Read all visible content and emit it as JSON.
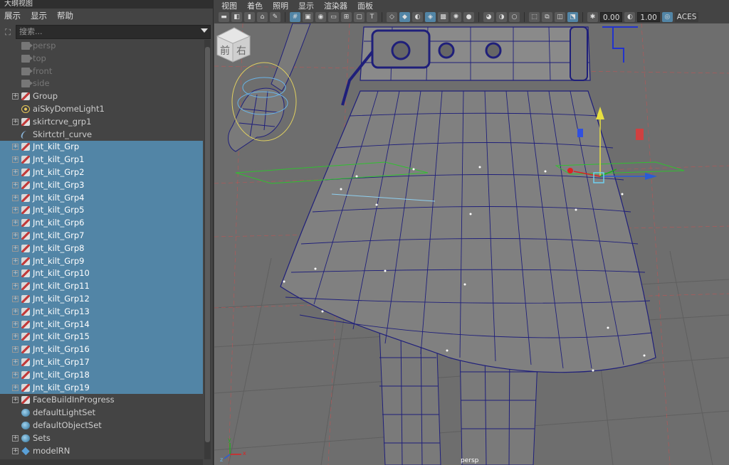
{
  "outliner": {
    "title": "大纲视图",
    "menu": [
      "展示",
      "显示",
      "帮助"
    ],
    "search_placeholder": "搜索...",
    "items": [
      {
        "label": "persp",
        "icon": "camera-icon",
        "dim": true,
        "expand": false,
        "selected": false
      },
      {
        "label": "top",
        "icon": "camera-icon",
        "dim": true,
        "expand": false,
        "selected": false
      },
      {
        "label": "front",
        "icon": "camera-icon",
        "dim": true,
        "expand": false,
        "selected": false
      },
      {
        "label": "side",
        "icon": "camera-icon",
        "dim": true,
        "expand": false,
        "selected": false
      },
      {
        "label": "Group",
        "icon": "group-icon",
        "dim": false,
        "expand": true,
        "selected": false
      },
      {
        "label": "aiSkyDomeLight1",
        "icon": "skydome-light-icon",
        "dim": false,
        "expand": false,
        "selected": false
      },
      {
        "label": "skirtcrve_grp1",
        "icon": "group-icon",
        "dim": false,
        "expand": true,
        "selected": false
      },
      {
        "label": "Skirtctrl_curve",
        "icon": "curve-icon",
        "dim": false,
        "expand": false,
        "selected": false
      },
      {
        "label": "Jnt_kilt_Grp",
        "icon": "group-icon",
        "dim": false,
        "expand": true,
        "selected": true
      },
      {
        "label": "Jnt_kilt_Grp1",
        "icon": "group-icon",
        "dim": false,
        "expand": true,
        "selected": true
      },
      {
        "label": "Jnt_kilt_Grp2",
        "icon": "group-icon",
        "dim": false,
        "expand": true,
        "selected": true
      },
      {
        "label": "Jnt_kilt_Grp3",
        "icon": "group-icon",
        "dim": false,
        "expand": true,
        "selected": true
      },
      {
        "label": "Jnt_kilt_Grp4",
        "icon": "group-icon",
        "dim": false,
        "expand": true,
        "selected": true
      },
      {
        "label": "Jnt_kilt_Grp5",
        "icon": "group-icon",
        "dim": false,
        "expand": true,
        "selected": true
      },
      {
        "label": "Jnt_kilt_Grp6",
        "icon": "group-icon",
        "dim": false,
        "expand": true,
        "selected": true
      },
      {
        "label": "Jnt_kilt_Grp7",
        "icon": "group-icon",
        "dim": false,
        "expand": true,
        "selected": true
      },
      {
        "label": "Jnt_kilt_Grp8",
        "icon": "group-icon",
        "dim": false,
        "expand": true,
        "selected": true
      },
      {
        "label": "Jnt_kilt_Grp9",
        "icon": "group-icon",
        "dim": false,
        "expand": true,
        "selected": true
      },
      {
        "label": "Jnt_kilt_Grp10",
        "icon": "group-icon",
        "dim": false,
        "expand": true,
        "selected": true
      },
      {
        "label": "Jnt_kilt_Grp11",
        "icon": "group-icon",
        "dim": false,
        "expand": true,
        "selected": true
      },
      {
        "label": "Jnt_kilt_Grp12",
        "icon": "group-icon",
        "dim": false,
        "expand": true,
        "selected": true
      },
      {
        "label": "Jnt_kilt_Grp13",
        "icon": "group-icon",
        "dim": false,
        "expand": true,
        "selected": true
      },
      {
        "label": "Jnt_kilt_Grp14",
        "icon": "group-icon",
        "dim": false,
        "expand": true,
        "selected": true
      },
      {
        "label": "Jnt_kilt_Grp15",
        "icon": "group-icon",
        "dim": false,
        "expand": true,
        "selected": true
      },
      {
        "label": "Jnt_kilt_Grp16",
        "icon": "group-icon",
        "dim": false,
        "expand": true,
        "selected": true
      },
      {
        "label": "Jnt_kilt_Grp17",
        "icon": "group-icon",
        "dim": false,
        "expand": true,
        "selected": true
      },
      {
        "label": "Jnt_kilt_Grp18",
        "icon": "group-icon",
        "dim": false,
        "expand": true,
        "selected": true
      },
      {
        "label": "Jnt_kilt_Grp19",
        "icon": "group-icon",
        "dim": false,
        "expand": true,
        "selected": true
      },
      {
        "label": "FaceBuildInProgress",
        "icon": "group-icon",
        "dim": false,
        "expand": true,
        "selected": false
      },
      {
        "label": "defaultLightSet",
        "icon": "set-icon",
        "dim": false,
        "expand": false,
        "selected": false
      },
      {
        "label": "defaultObjectSet",
        "icon": "set-icon",
        "dim": false,
        "expand": false,
        "selected": false
      },
      {
        "label": "Sets",
        "icon": "set-icon",
        "dim": false,
        "expand": true,
        "selected": false
      },
      {
        "label": "modelRN",
        "icon": "reference-icon",
        "dim": false,
        "expand": true,
        "selected": false
      }
    ],
    "selection_color": "#5285a6"
  },
  "viewport": {
    "menu": [
      "视图",
      "着色",
      "照明",
      "显示",
      "渲染器",
      "面板"
    ],
    "field_a": "0.00",
    "field_b": "1.00",
    "color_space": "ACES",
    "camera_label": "persp",
    "viewcube_front": "前",
    "viewcube_right": "右",
    "axis_x": "x",
    "axis_y": "y",
    "axis_z": "z",
    "wire_color": "#1f1f7a",
    "background_color": "#6e6e6e"
  }
}
